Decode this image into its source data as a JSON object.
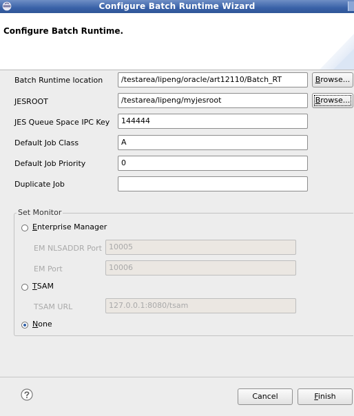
{
  "window": {
    "title": "Configure Batch Runtime Wizard"
  },
  "banner": {
    "title": "Configure Batch Runtime."
  },
  "form": {
    "batch_runtime_location": {
      "label": "Batch Runtime location",
      "value": "/testarea/lipeng/oracle/art12110/Batch_RT",
      "browse_prefix": "B",
      "browse_rest": "rowse..."
    },
    "jesroot": {
      "label": "JESROOT",
      "value": "/testarea/lipeng/myjesroot",
      "browse_prefix": "B",
      "browse_rest": "rowse..."
    },
    "jes_queue_space_ipc_key": {
      "label": "JES Queue Space IPC Key",
      "value": "144444"
    },
    "default_job_class": {
      "label": "Default Job Class",
      "value": "A"
    },
    "default_job_priority": {
      "label": "Default Job Priority",
      "value": "0"
    },
    "duplicate_job": {
      "label": "Duplicate Job",
      "value": ""
    }
  },
  "monitor": {
    "group_title": "Set Monitor",
    "enterprise_manager": {
      "mnemonic": "E",
      "rest": "nterprise Manager",
      "selected": false
    },
    "em_nlsaddr_port": {
      "label": "EM NLSADDR Port",
      "value": "10005"
    },
    "em_port": {
      "label": "EM Port",
      "value": "10006"
    },
    "tsam": {
      "mnemonic": "T",
      "rest": "SAM",
      "selected": false
    },
    "tsam_url": {
      "label": "TSAM URL",
      "value": "127.0.0.1:8080/tsam"
    },
    "none": {
      "mnemonic": "N",
      "rest": "one",
      "selected": true
    }
  },
  "footer": {
    "cancel_label": "Cancel",
    "finish_mnemonic": "F",
    "finish_rest": "inish"
  },
  "colors": {
    "titlebar": "#3a62a8",
    "radio_selected": "#2f5fa7",
    "dialog_bg": "#ededed"
  },
  "icons": {
    "app": "eclipse-icon",
    "help": "help-icon"
  }
}
